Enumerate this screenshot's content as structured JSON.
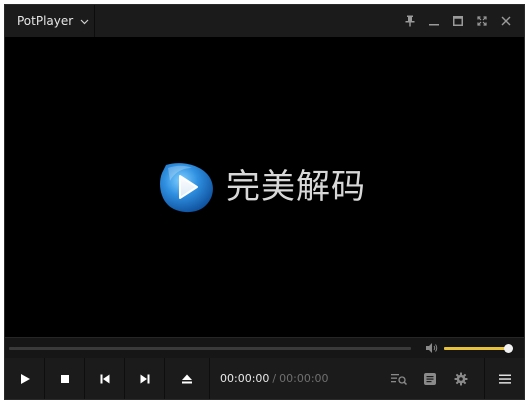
{
  "titlebar": {
    "app_name": "PotPlayer",
    "icons": {
      "app_menu": "chevron-down-icon",
      "pin": "pin-icon",
      "minimize": "minimize-icon",
      "maximize": "maximize-icon",
      "fullscreen": "fullscreen-icon",
      "close": "close-icon"
    }
  },
  "video": {
    "logo_text": "完美解码",
    "logo_icon": "play-logo-icon"
  },
  "seek": {
    "progress": 0
  },
  "volume": {
    "level": 1.0,
    "icon": "volume-icon",
    "color": "#e8c23a"
  },
  "controls": {
    "buttons": [
      "play-icon",
      "stop-icon",
      "previous-icon",
      "next-icon",
      "eject-icon"
    ],
    "current_time": "00:00:00",
    "separator": "/",
    "total_time": "00:00:00",
    "right_buttons": [
      "playlist-search-icon",
      "subtitle-icon",
      "settings-icon",
      "menu-icon"
    ]
  },
  "colors": {
    "background": "#000000",
    "bar": "#1b1b1b",
    "accent": "#e8c23a",
    "logo_blue": "#2f8fe0"
  }
}
